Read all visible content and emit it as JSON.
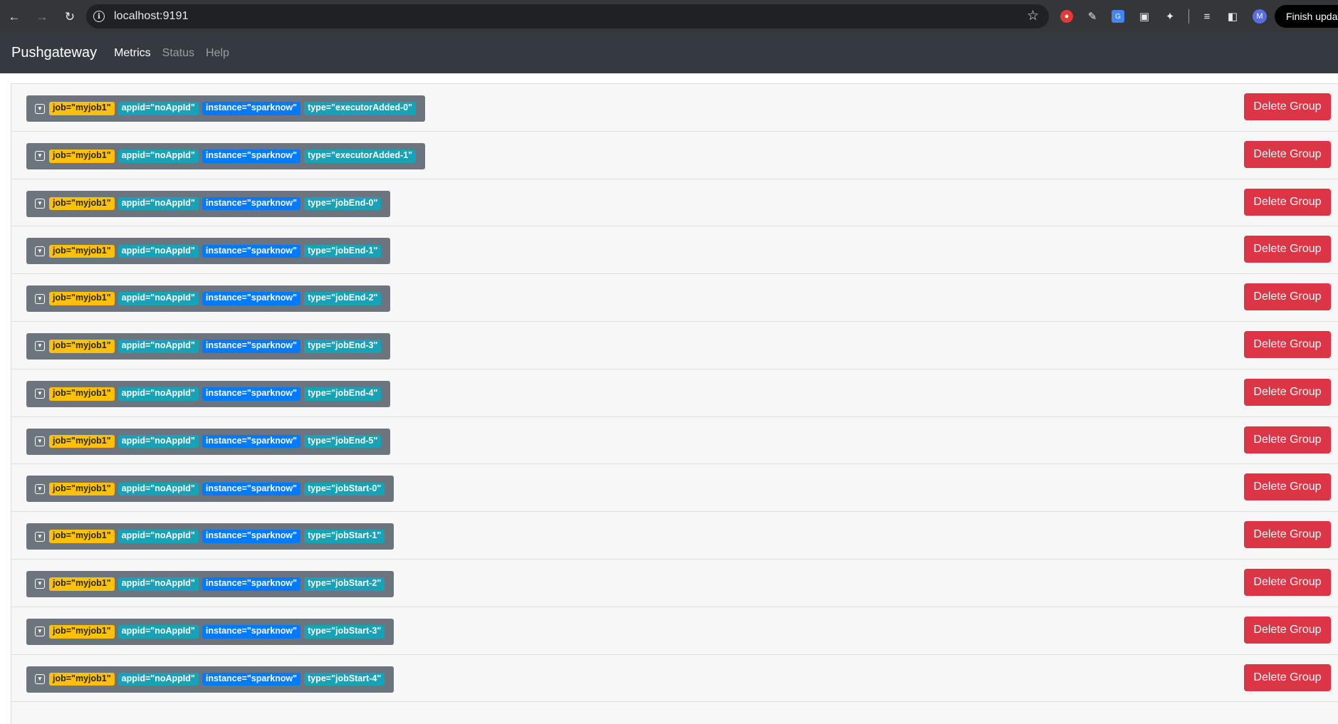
{
  "browser": {
    "url": "localhost:9191",
    "finish_update_label": "Finish update",
    "avatar_letter": "M"
  },
  "navbar": {
    "brand": "Pushgateway",
    "links": [
      "Metrics",
      "Status",
      "Help"
    ],
    "active": "Metrics"
  },
  "colors": {
    "navbar_bg": "#343a40",
    "job_label": "#ffc107",
    "appid_label": "#17a2b8",
    "instance_label": "#007bff",
    "type_label": "#17a2b8",
    "delete_button": "#dc3545"
  },
  "delete_label": "Delete Group",
  "groups": [
    {
      "job": "job=\"myjob1\"",
      "appid": "appid=\"noAppId\"",
      "instance": "instance=\"sparknow\"",
      "type": "type=\"executorAdded-0\""
    },
    {
      "job": "job=\"myjob1\"",
      "appid": "appid=\"noAppId\"",
      "instance": "instance=\"sparknow\"",
      "type": "type=\"executorAdded-1\""
    },
    {
      "job": "job=\"myjob1\"",
      "appid": "appid=\"noAppId\"",
      "instance": "instance=\"sparknow\"",
      "type": "type=\"jobEnd-0\""
    },
    {
      "job": "job=\"myjob1\"",
      "appid": "appid=\"noAppId\"",
      "instance": "instance=\"sparknow\"",
      "type": "type=\"jobEnd-1\""
    },
    {
      "job": "job=\"myjob1\"",
      "appid": "appid=\"noAppId\"",
      "instance": "instance=\"sparknow\"",
      "type": "type=\"jobEnd-2\""
    },
    {
      "job": "job=\"myjob1\"",
      "appid": "appid=\"noAppId\"",
      "instance": "instance=\"sparknow\"",
      "type": "type=\"jobEnd-3\""
    },
    {
      "job": "job=\"myjob1\"",
      "appid": "appid=\"noAppId\"",
      "instance": "instance=\"sparknow\"",
      "type": "type=\"jobEnd-4\""
    },
    {
      "job": "job=\"myjob1\"",
      "appid": "appid=\"noAppId\"",
      "instance": "instance=\"sparknow\"",
      "type": "type=\"jobEnd-5\""
    },
    {
      "job": "job=\"myjob1\"",
      "appid": "appid=\"noAppId\"",
      "instance": "instance=\"sparknow\"",
      "type": "type=\"jobStart-0\""
    },
    {
      "job": "job=\"myjob1\"",
      "appid": "appid=\"noAppId\"",
      "instance": "instance=\"sparknow\"",
      "type": "type=\"jobStart-1\""
    },
    {
      "job": "job=\"myjob1\"",
      "appid": "appid=\"noAppId\"",
      "instance": "instance=\"sparknow\"",
      "type": "type=\"jobStart-2\""
    },
    {
      "job": "job=\"myjob1\"",
      "appid": "appid=\"noAppId\"",
      "instance": "instance=\"sparknow\"",
      "type": "type=\"jobStart-3\""
    },
    {
      "job": "job=\"myjob1\"",
      "appid": "appid=\"noAppId\"",
      "instance": "instance=\"sparknow\"",
      "type": "type=\"jobStart-4\""
    }
  ]
}
